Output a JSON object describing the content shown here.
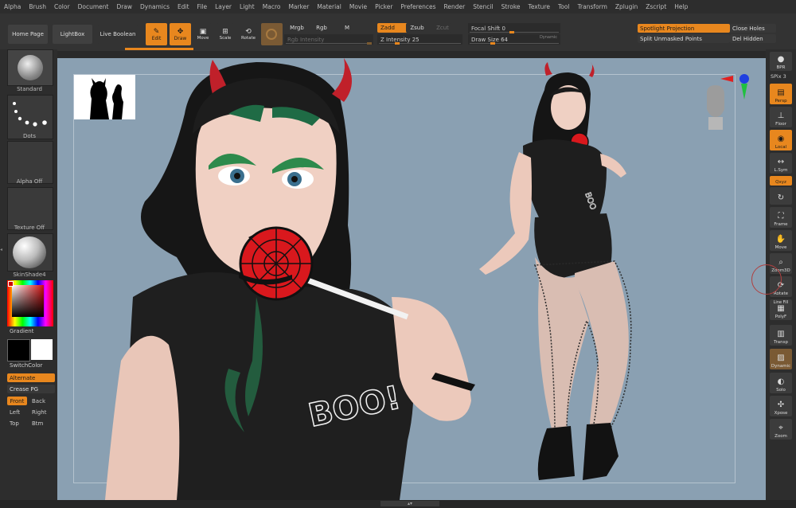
{
  "menu": [
    "Alpha",
    "Brush",
    "Color",
    "Document",
    "Draw",
    "Dynamics",
    "Edit",
    "File",
    "Layer",
    "Light",
    "Macro",
    "Marker",
    "Material",
    "Movie",
    "Picker",
    "Preferences",
    "Render",
    "Stencil",
    "Stroke",
    "Texture",
    "Tool",
    "Transform",
    "Zplugin",
    "Zscript",
    "Help"
  ],
  "toolbar": {
    "home_page": "Home Page",
    "lightbox": "LightBox",
    "live_boolean": "Live Boolean",
    "edit": "Edit",
    "draw": "Draw",
    "move": "Move",
    "scale": "Scale",
    "rotate": "Rotate",
    "mrgb": "Mrgb",
    "rgb": "Rgb",
    "m": "M",
    "rgb_intensity": "Rgb Intensity",
    "zadd": "Zadd",
    "zsub": "Zsub",
    "zcut": "Zcut",
    "z_intensity": "Z Intensity 25",
    "focal_shift": "Focal Shift 0",
    "draw_size": "Draw Size 64",
    "dynamic": "Dynamic",
    "spotlight": "Spotlight Projection",
    "split_unmasked": "Split Unmasked Points",
    "close_holes": "Close Holes",
    "del_hidden": "Del Hidden"
  },
  "left": {
    "brush": "Standard",
    "stroke": "Dots",
    "alpha": "Alpha Off",
    "texture": "Texture Off",
    "material": "SkinShade4",
    "gradient": "Gradient",
    "switch_color": "SwitchColor",
    "alternate": "Alternate",
    "crease_pg": "Crease PG",
    "front": "Front",
    "back": "Back",
    "left": "Left",
    "right": "Right",
    "top": "Top",
    "btm": "Btm"
  },
  "right": {
    "bpr": "BPR",
    "spix": "SPix 3",
    "persp": "Persp",
    "floor": "Floor",
    "local": "Local",
    "lsym": "L.Sym",
    "xyz": "Qxyz",
    "frame": "Frame",
    "move": "Move",
    "zoom3d": "Zoom3D",
    "rotate": "Rotate",
    "line_fill": "Line Fill",
    "polyf": "PolyF",
    "transp": "Transp",
    "dynamic": "Dynamic",
    "solo": "Solo",
    "xpose": "Xpose",
    "zoom": "Zoom"
  },
  "canvas": {
    "shirt_text": "BOO!"
  },
  "colors": {
    "accent": "#e8871e",
    "canvas_bg": "#8aa0b2",
    "panel": "#2d2d2d"
  }
}
